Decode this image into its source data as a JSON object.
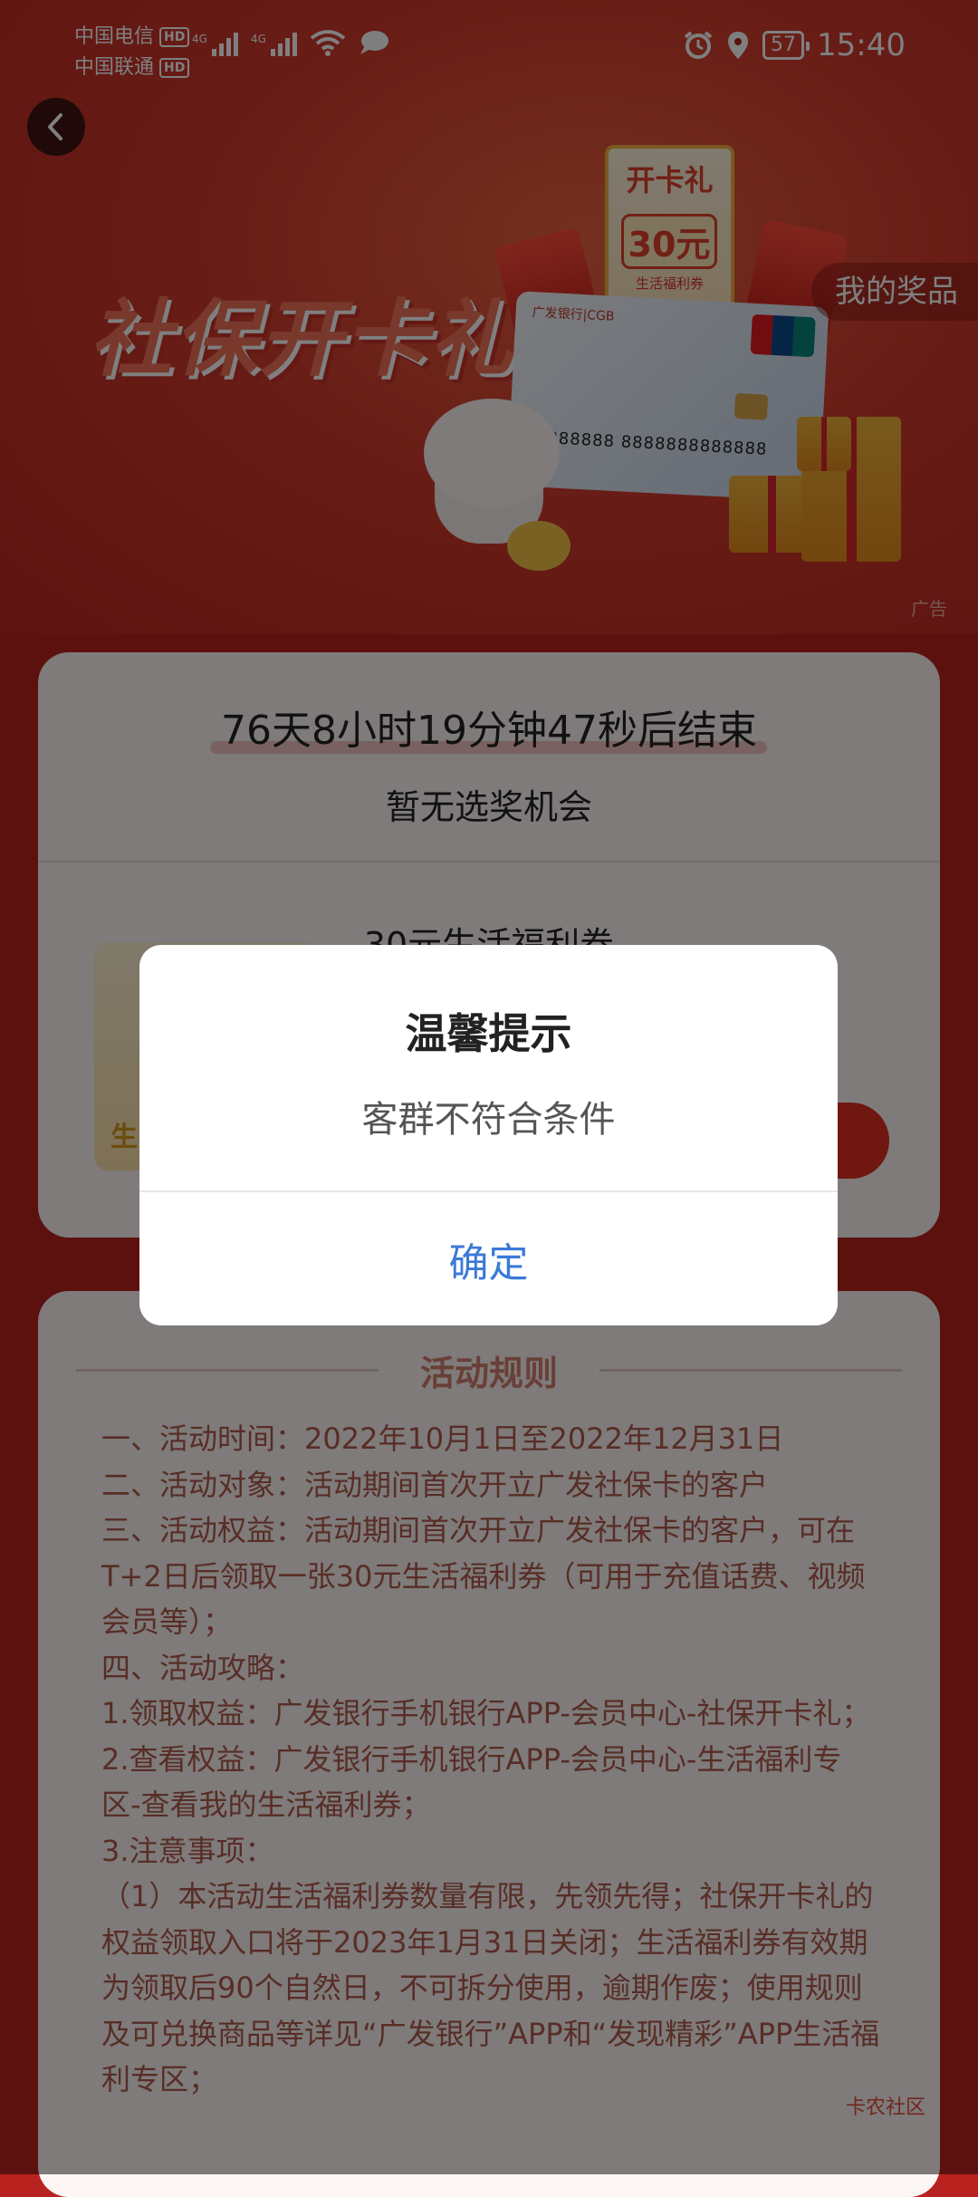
{
  "status_bar": {
    "carrier_1": "中国电信",
    "carrier_2": "中国联通",
    "hd": "HD",
    "network": "4G",
    "battery": "57",
    "time": "15:40"
  },
  "banner": {
    "title": "社保开卡礼",
    "ticket_title": "开卡礼",
    "ticket_amount": "30元",
    "ticket_sub": "生活福利券",
    "card_bank": "广发银行|CGB",
    "card_number": "888888 8888888888888",
    "ad_label": "广告",
    "my_prize": "我的奖品"
  },
  "activity": {
    "countdown": "76天8小时19分钟47秒后结束",
    "no_chance": "暂无选奖机会",
    "coupon_title": "30元生活福利券",
    "coupon_thumb_label": "生"
  },
  "rules": {
    "title": "活动规则",
    "lines": [
      "一、活动时间：2022年10月1日至2022年12月31日",
      "二、活动对象：活动期间首次开立广发社保卡的客户",
      "三、活动权益：活动期间首次开立广发社保卡的客户，可在T+2日后领取一张30元生活福利券（可用于充值话费、视频会员等）；",
      "四、活动攻略：",
      "1.领取权益：广发银行手机银行APP-会员中心-社保开卡礼；",
      "2.查看权益：广发银行手机银行APP-会员中心-生活福利专区-查看我的生活福利券；",
      "3.注意事项：",
      "（1）本活动生活福利券数量有限，先领先得；社保开卡礼的权益领取入口将于2023年1月31日关闭；生活福利券有效期为领取后90个自然日，不可拆分使用，逾期作废；使用规则及可兑换商品等详见“广发银行”APP和“发现精彩”APP生活福利专区；"
    ]
  },
  "watermark": "卡农社区",
  "dialog": {
    "title": "温馨提示",
    "message": "客群不符合条件",
    "confirm": "确定"
  },
  "colors": {
    "background": "#b9231f",
    "accent_blue": "#3b7ad8",
    "claim_red": "#e12f22"
  },
  "icons": [
    "back-arrow-icon",
    "alarm-icon",
    "location-icon",
    "wifi-icon",
    "chat-bubble-icon",
    "battery-icon"
  ]
}
